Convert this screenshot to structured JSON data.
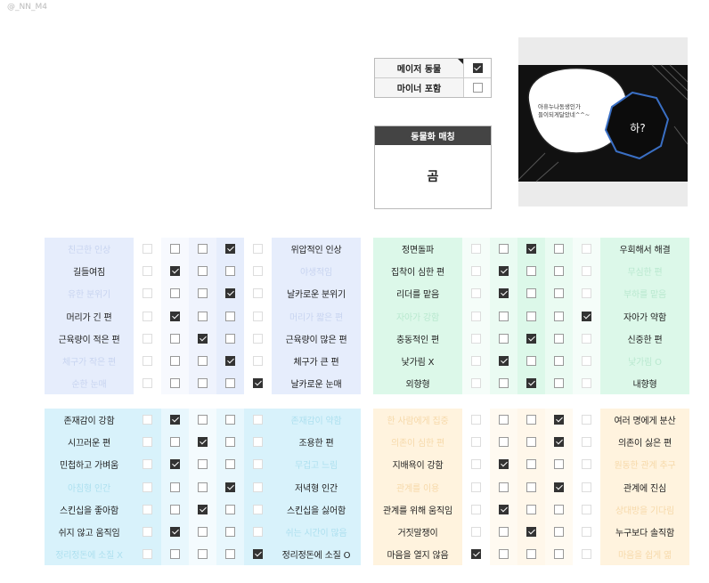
{
  "watermark": "@_NN_M4",
  "animal_type": {
    "rows": [
      {
        "label": "메이저 동물",
        "checked": true
      },
      {
        "label": "마이너 포함",
        "checked": false
      }
    ]
  },
  "match": {
    "title": "동물화 매칭",
    "result": "곰"
  },
  "comic": {
    "bubble_text": "아휴누나동생인가\n들이되게달았네^^~",
    "reply_text": "하?"
  },
  "panels": [
    {
      "id": "blue",
      "rows": [
        {
          "left": "친근한 인상",
          "right": "위압적인 인상",
          "sel": 3
        },
        {
          "left": "길들여짐",
          "right": "야생적임",
          "sel": 1
        },
        {
          "left": "유한 분위기",
          "right": "날카로운 분위기",
          "sel": 3
        },
        {
          "left": "머리가 긴 편",
          "right": "머리가 짧은 편",
          "sel": 1
        },
        {
          "left": "근육량이 적은 편",
          "right": "근육량이 많은 편",
          "sel": 2
        },
        {
          "left": "체구가 작은 편",
          "right": "체구가 큰 편",
          "sel": 3
        },
        {
          "left": "순한 눈매",
          "right": "날카로운 눈매",
          "sel": 4
        }
      ]
    },
    {
      "id": "green",
      "rows": [
        {
          "left": "정면돌파",
          "right": "우회해서 해결",
          "sel": 2
        },
        {
          "left": "집착이 심한 편",
          "right": "무심한 편",
          "sel": 1
        },
        {
          "left": "리더를 맡음",
          "right": "부하를 맡음",
          "sel": 1
        },
        {
          "left": "자아가 강함",
          "right": "자아가 약함",
          "sel": 4
        },
        {
          "left": "충동적인 편",
          "right": "신중한 편",
          "sel": 2
        },
        {
          "left": "낯가림 X",
          "right": "낯가림 O",
          "sel": 1
        },
        {
          "left": "외향형",
          "right": "내향형",
          "sel": 2
        }
      ]
    },
    {
      "id": "cyan",
      "rows": [
        {
          "left": "존재감이 강함",
          "right": "존재감이 약함",
          "sel": 1
        },
        {
          "left": "시끄러운 편",
          "right": "조용한 편",
          "sel": 2
        },
        {
          "left": "민첩하고 가벼움",
          "right": "무겁고 느림",
          "sel": 1
        },
        {
          "left": "아침형 인간",
          "right": "저녁형 인간",
          "sel": 3
        },
        {
          "left": "스킨십을 좋아함",
          "right": "스킨십을 싫어함",
          "sel": 2
        },
        {
          "left": "쉬지 않고 움직임",
          "right": "쉬는 시간이 많음",
          "sel": 1
        },
        {
          "left": "정리정돈에 소질 X",
          "right": "정리정돈에 소질 O",
          "sel": 4
        }
      ]
    },
    {
      "id": "orange",
      "rows": [
        {
          "left": "한 사람에게 집중",
          "right": "여러 명에게 분산",
          "sel": 3
        },
        {
          "left": "의존이 심한 편",
          "right": "의존이 싫은 편",
          "sel": 3
        },
        {
          "left": "지배욕이 강함",
          "right": "원동한 관계 추구",
          "sel": 1
        },
        {
          "left": "관계를 이용",
          "right": "관계에 진심",
          "sel": 3
        },
        {
          "left": "관계를 위해 움직임",
          "right": "상대방을 기다림",
          "sel": 1
        },
        {
          "left": "거짓말쟁이",
          "right": "누구보다 솔직함",
          "sel": 2
        },
        {
          "left": "마음을 열지 않음",
          "right": "마음을 쉽게 엶",
          "sel": 0
        }
      ]
    }
  ]
}
